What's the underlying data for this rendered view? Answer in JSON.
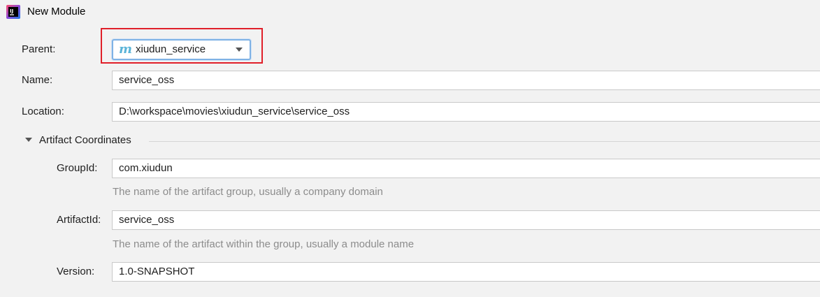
{
  "window": {
    "title": "New Module",
    "icon": "intellij-idea-icon"
  },
  "parent": {
    "label": "Parent:",
    "value": "xiudun_service",
    "icon": "maven-module-icon",
    "icon_glyph": "m"
  },
  "name": {
    "label": "Name:",
    "value": "service_oss"
  },
  "location": {
    "label": "Location:",
    "value": "D:\\workspace\\movies\\xiudun_service\\service_oss"
  },
  "artifact_section": {
    "title": "Artifact Coordinates",
    "expanded": true
  },
  "group_id": {
    "label": "GroupId:",
    "value": "com.xiudun",
    "hint": "The name of the artifact group, usually a company domain"
  },
  "artifact_id": {
    "label": "ArtifactId:",
    "value": "service_oss",
    "hint": "The name of the artifact within the group, usually a module name"
  },
  "version": {
    "label": "Version:",
    "value": "1.0-SNAPSHOT"
  },
  "colors": {
    "background": "#f2f2f2",
    "highlight": "#e0202a",
    "focus_border": "#7fb2e5",
    "maven_icon": "#5ab4d8",
    "hint_text": "#8c8c8c"
  }
}
